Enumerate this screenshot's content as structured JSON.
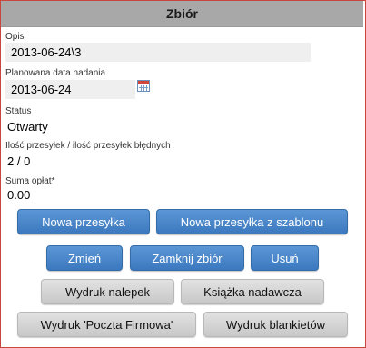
{
  "header": {
    "title": "Zbiór"
  },
  "form": {
    "opis": {
      "label": "Opis",
      "value": "2013-06-24\\3"
    },
    "data_nadania": {
      "label": "Planowana data nadania",
      "value": "2013-06-24"
    },
    "status": {
      "label": "Status",
      "value": "Otwarty"
    },
    "ilosc": {
      "label": "Ilość przesyłek / ilość przesyłek błędnych",
      "value": "2 / 0"
    },
    "suma": {
      "label": "Suma opłat*",
      "value": "0.00"
    }
  },
  "buttons": {
    "nowa_przesylka": "Nowa przesyłka",
    "nowa_z_szablonu": "Nowa przesyłka z szablonu",
    "zmien": "Zmień",
    "zamknij": "Zamknij zbiór",
    "usun": "Usuń",
    "wydruk_nalepek": "Wydruk nalepek",
    "ksiazka": "Książka nadawcza",
    "poczta_firmowa": "Wydruk 'Poczta Firmowa'",
    "blankiety": "Wydruk blankietów"
  },
  "colors": {
    "titlebar": "#a8a8a8",
    "primary_button": "#4a86c9",
    "secondary_button": "#d6d6d6",
    "frame_border": "#c9463d"
  },
  "icons": {
    "date_picker": "calendar-icon"
  }
}
